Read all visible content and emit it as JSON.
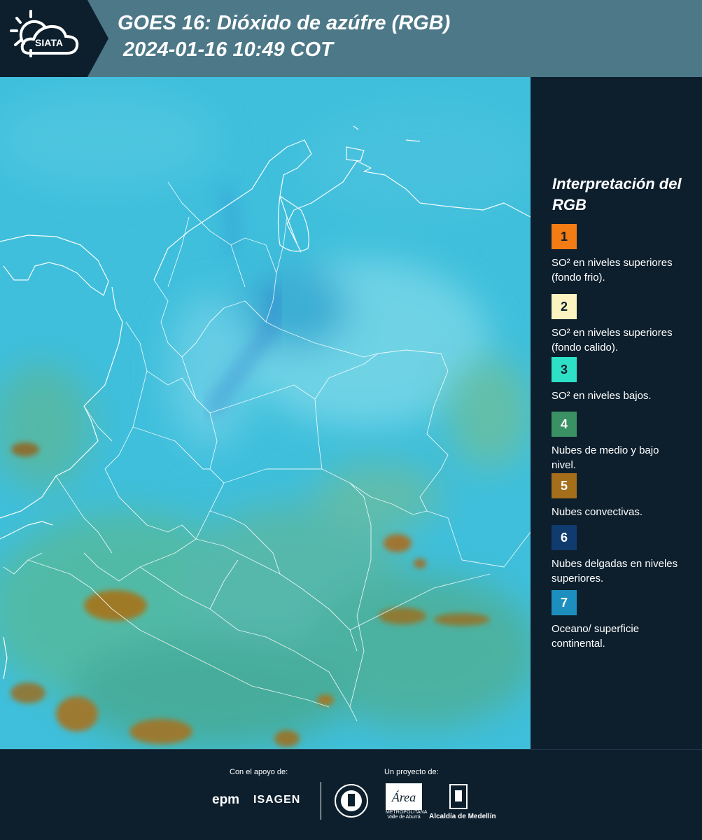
{
  "header": {
    "title_line1": "GOES 16: Dióxido de azúfre (RGB)",
    "title_line2": " 2024-01-16 10:49 COT",
    "logo_text": "SIATA"
  },
  "legend": {
    "title": "Interpretación del RGB",
    "items": [
      {
        "num": "1",
        "color": "#f47c14",
        "text": "SO² en niveles superiores (fondo frio)."
      },
      {
        "num": "2",
        "color": "#fbf4c0",
        "text": "SO² en niveles superiores (fondo calido)."
      },
      {
        "num": "3",
        "color": "#2de0c6",
        "text": "SO² en niveles bajos."
      },
      {
        "num": "4",
        "color": "#3a9163",
        "text": "Nubes de medio y bajo nivel."
      },
      {
        "num": "5",
        "color": "#a46e1a",
        "text": "Nubes convectivas."
      },
      {
        "num": "6",
        "color": "#0f3b6e",
        "text": "Nubes delgadas en niveles superiores."
      },
      {
        "num": "7",
        "color": "#1d8fbf",
        "text": "Oceano/ superficie continental."
      }
    ]
  },
  "footer": {
    "support_label": "Con el apoyo de:",
    "project_label": "Un proyecto de:",
    "epm": "epm",
    "isagen": "ISAGEN",
    "area": "Área",
    "area_sub": "METROPOLITANA Valle de Aburrá",
    "alcaldia": "Alcaldía de Medellín"
  },
  "map": {
    "background_color": "#3fbfdc",
    "border_color": "#ffffff"
  }
}
